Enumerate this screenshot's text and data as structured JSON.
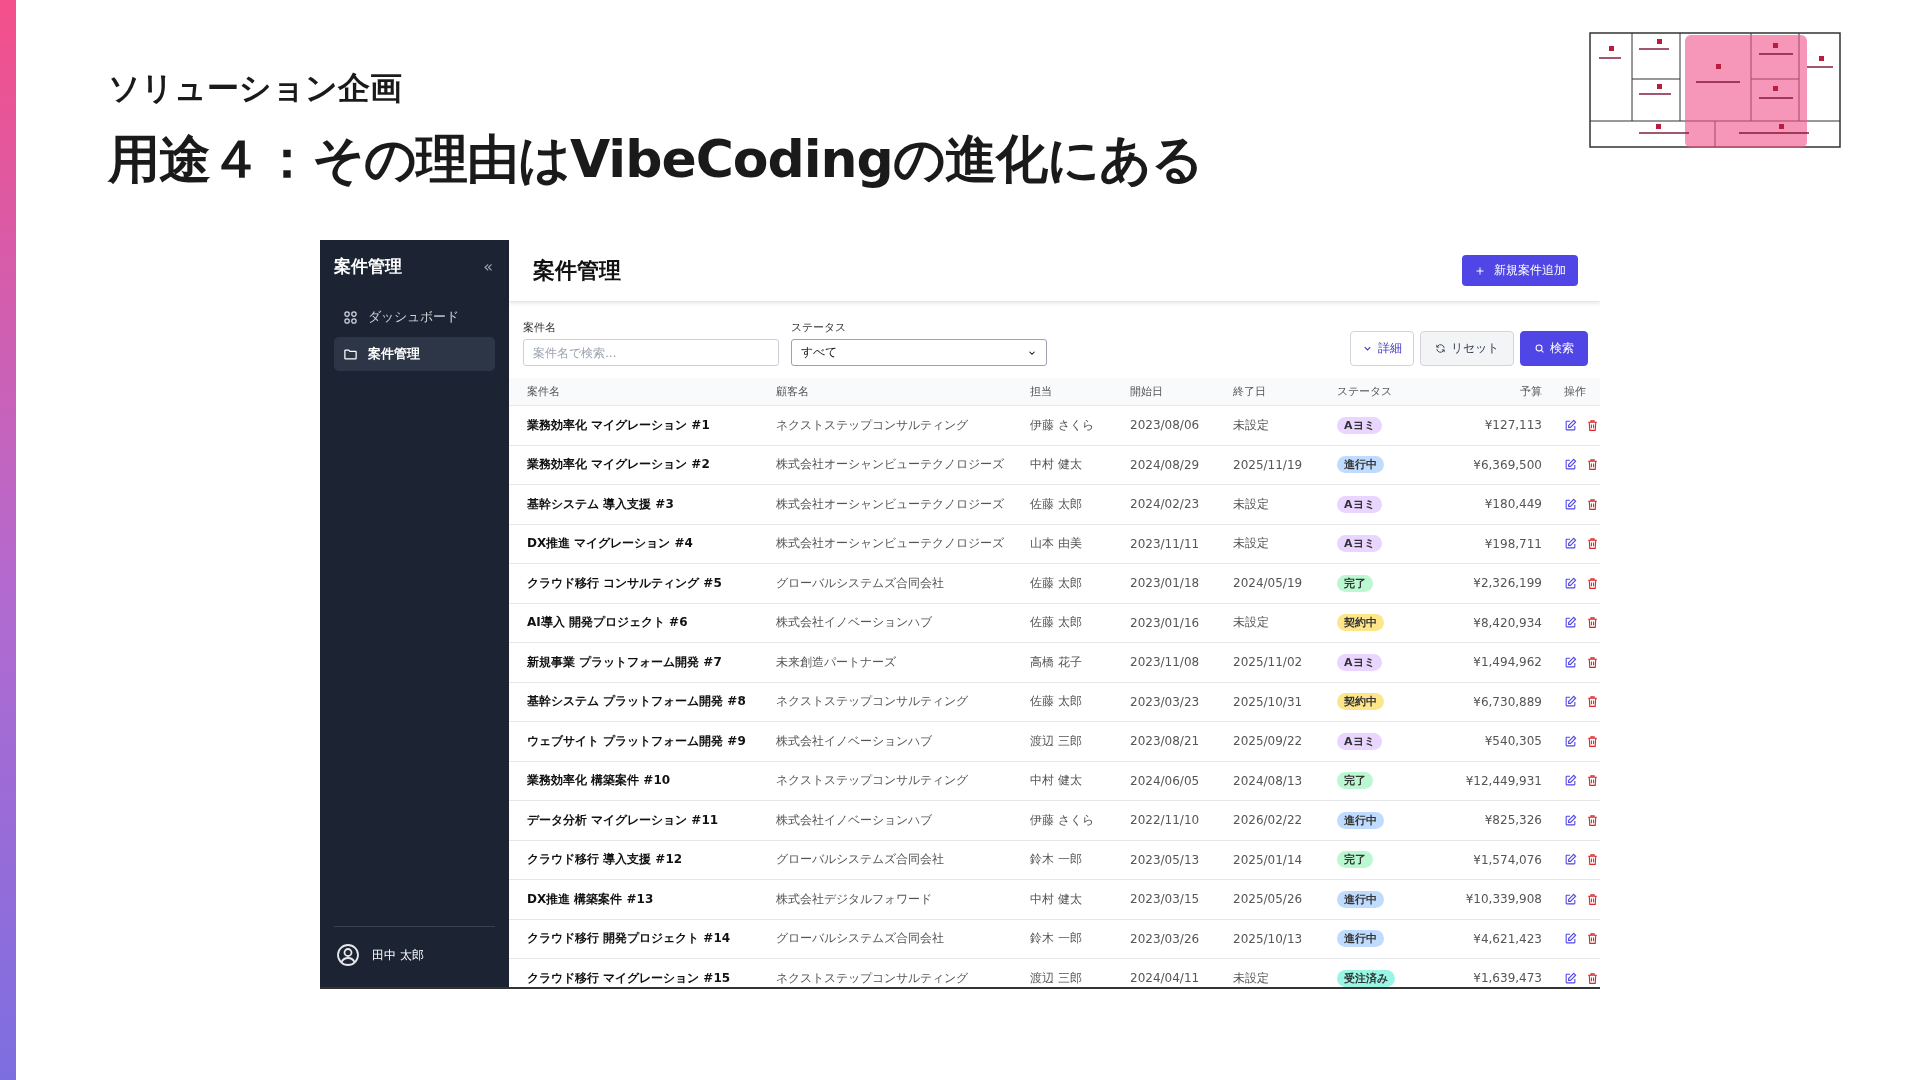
{
  "slide": {
    "subtitle": "ソリューション企画",
    "title": "用途４：その理由はVibeCodingの進化にある"
  },
  "sidebar": {
    "title": "案件管理",
    "collapse": "«",
    "items": [
      {
        "label": "ダッシュボード",
        "selected": false
      },
      {
        "label": "案件管理",
        "selected": true
      }
    ],
    "user": "田中 太郎"
  },
  "header": {
    "title": "案件管理",
    "add_button": "新規案件追加"
  },
  "filters": {
    "name_label": "案件名",
    "name_placeholder": "案件名で検索...",
    "status_label": "ステータス",
    "status_value": "すべて",
    "buttons": [
      {
        "label": "詳細",
        "kind": "toggle"
      },
      {
        "label": "リセット",
        "kind": "reset"
      },
      {
        "label": "検索",
        "kind": "search"
      }
    ]
  },
  "table": {
    "columns": [
      "案件名",
      "顧客名",
      "担当",
      "開始日",
      "終了日",
      "ステータス",
      "予算",
      "操作"
    ],
    "rows": [
      {
        "name": "業務効率化 マイグレーション #1",
        "client": "ネクストステップコンサルティング",
        "owner": "伊藤 さくら",
        "start": "2023/08/06",
        "end": "未設定",
        "status": {
          "label": "Aヨミ",
          "color": "#e9d5ff"
        },
        "budget": "¥127,113"
      },
      {
        "name": "業務効率化 マイグレーション #2",
        "client": "株式会社オーシャンビューテクノロジーズ",
        "owner": "中村 健太",
        "start": "2024/08/29",
        "end": "2025/11/19",
        "status": {
          "label": "進行中",
          "color": "#bfdbfe"
        },
        "budget": "¥6,369,500"
      },
      {
        "name": "基幹システム 導入支援 #3",
        "client": "株式会社オーシャンビューテクノロジーズ",
        "owner": "佐藤 太郎",
        "start": "2024/02/23",
        "end": "未設定",
        "status": {
          "label": "Aヨミ",
          "color": "#e9d5ff"
        },
        "budget": "¥180,449"
      },
      {
        "name": "DX推進 マイグレーション #4",
        "client": "株式会社オーシャンビューテクノロジーズ",
        "owner": "山本 由美",
        "start": "2023/11/11",
        "end": "未設定",
        "status": {
          "label": "Aヨミ",
          "color": "#e9d5ff"
        },
        "budget": "¥198,711"
      },
      {
        "name": "クラウド移行 コンサルティング #5",
        "client": "グローバルシステムズ合同会社",
        "owner": "佐藤 太郎",
        "start": "2023/01/18",
        "end": "2024/05/19",
        "status": {
          "label": "完了",
          "color": "#bbf7d0"
        },
        "budget": "¥2,326,199"
      },
      {
        "name": "AI導入 開発プロジェクト #6",
        "client": "株式会社イノベーションハブ",
        "owner": "佐藤 太郎",
        "start": "2023/01/16",
        "end": "未設定",
        "status": {
          "label": "契約中",
          "color": "#fde68a"
        },
        "budget": "¥8,420,934"
      },
      {
        "name": "新規事業 プラットフォーム開発 #7",
        "client": "未来創造パートナーズ",
        "owner": "高橋 花子",
        "start": "2023/11/08",
        "end": "2025/11/02",
        "status": {
          "label": "Aヨミ",
          "color": "#e9d5ff"
        },
        "budget": "¥1,494,962"
      },
      {
        "name": "基幹システム プラットフォーム開発 #8",
        "client": "ネクストステップコンサルティング",
        "owner": "佐藤 太郎",
        "start": "2023/03/23",
        "end": "2025/10/31",
        "status": {
          "label": "契約中",
          "color": "#fde68a"
        },
        "budget": "¥6,730,889"
      },
      {
        "name": "ウェブサイト プラットフォーム開発 #9",
        "client": "株式会社イノベーションハブ",
        "owner": "渡辺 三郎",
        "start": "2023/08/21",
        "end": "2025/09/22",
        "status": {
          "label": "Aヨミ",
          "color": "#e9d5ff"
        },
        "budget": "¥540,305"
      },
      {
        "name": "業務効率化 構築案件 #10",
        "client": "ネクストステップコンサルティング",
        "owner": "中村 健太",
        "start": "2024/06/05",
        "end": "2024/08/13",
        "status": {
          "label": "完了",
          "color": "#bbf7d0"
        },
        "budget": "¥12,449,931"
      },
      {
        "name": "データ分析 マイグレーション #11",
        "client": "株式会社イノベーションハブ",
        "owner": "伊藤 さくら",
        "start": "2022/11/10",
        "end": "2026/02/22",
        "status": {
          "label": "進行中",
          "color": "#bfdbfe"
        },
        "budget": "¥825,326"
      },
      {
        "name": "クラウド移行 導入支援 #12",
        "client": "グローバルシステムズ合同会社",
        "owner": "鈴木 一郎",
        "start": "2023/05/13",
        "end": "2025/01/14",
        "status": {
          "label": "完了",
          "color": "#bbf7d0"
        },
        "budget": "¥1,574,076"
      },
      {
        "name": "DX推進 構築案件 #13",
        "client": "株式会社デジタルフォワード",
        "owner": "中村 健太",
        "start": "2023/03/15",
        "end": "2025/05/26",
        "status": {
          "label": "進行中",
          "color": "#bfdbfe"
        },
        "budget": "¥10,339,908"
      },
      {
        "name": "クラウド移行 開発プロジェクト #14",
        "client": "グローバルシステムズ合同会社",
        "owner": "鈴木 一郎",
        "start": "2023/03/26",
        "end": "2025/10/13",
        "status": {
          "label": "進行中",
          "color": "#bfdbfe"
        },
        "budget": "¥4,621,423"
      },
      {
        "name": "クラウド移行 マイグレーション #15",
        "client": "ネクストステップコンサルティング",
        "owner": "渡辺 三郎",
        "start": "2024/04/11",
        "end": "未設定",
        "status": {
          "label": "受注済み",
          "color": "#99f6e4"
        },
        "budget": "¥1,639,473"
      }
    ]
  }
}
